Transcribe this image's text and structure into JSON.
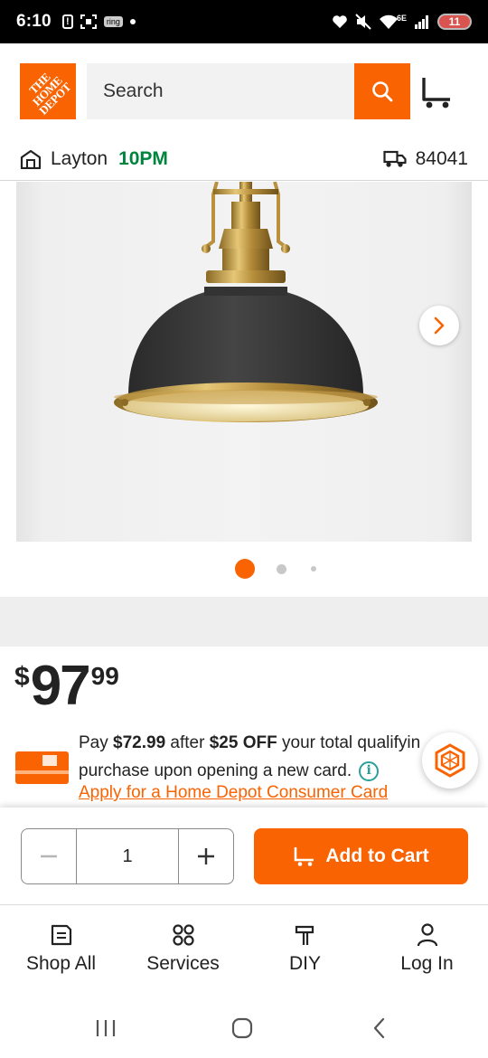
{
  "status_bar": {
    "time": "6:10",
    "ring_badge": "ring",
    "network": "6E",
    "battery": "11"
  },
  "header": {
    "logo_text": "THE HOME DEPOT",
    "search_placeholder": "Search"
  },
  "location": {
    "store_name": "Layton",
    "store_hours": "10PM",
    "zip_code": "84041"
  },
  "product": {
    "price": {
      "currency": "$",
      "dollars": "97",
      "cents": "99"
    },
    "carousel": {
      "total_slides": 3,
      "active_index": 0
    }
  },
  "card_offer": {
    "line_pay": "Pay ",
    "discount_price": "$72.99",
    "after_text": " after ",
    "discount_amount": "$25 OFF",
    "rest_line1": " your total qualifyin",
    "line2": "purchase upon opening a new card.",
    "apply_link": "Apply for a Home Depot Consumer Card"
  },
  "cart_bar": {
    "quantity": "1",
    "add_to_cart_label": "Add to Cart"
  },
  "bottom_nav": {
    "items": [
      {
        "label": "Shop All",
        "icon": "shop-all-icon"
      },
      {
        "label": "Services",
        "icon": "services-icon"
      },
      {
        "label": "DIY",
        "icon": "diy-icon"
      },
      {
        "label": "Log In",
        "icon": "user-icon"
      }
    ]
  },
  "colors": {
    "brand_orange": "#f96302",
    "store_hours_green": "#00843d",
    "info_teal": "#2aa198"
  }
}
